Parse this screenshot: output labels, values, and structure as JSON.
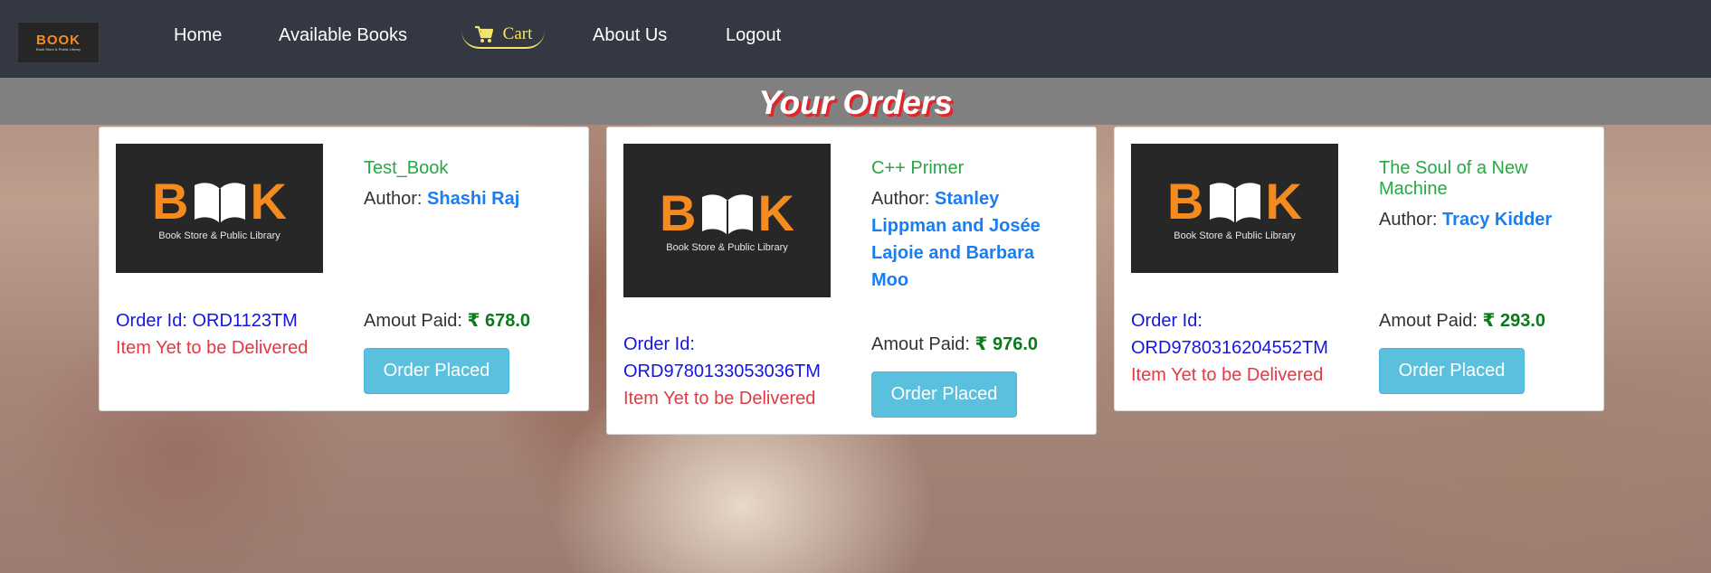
{
  "brand": {
    "logo_text": "BOOK",
    "logo_sub": "Book Store & Public Library"
  },
  "nav": {
    "home": "Home",
    "available_books": "Available Books",
    "cart": "Cart",
    "about": "About Us",
    "logout": "Logout"
  },
  "page_title": "Your Orders",
  "orders": [
    {
      "cover_text": "BOOK",
      "cover_sub": "Book Store & Public Library",
      "title": "Test_Book",
      "author_label": "Author:",
      "author": "Shashi Raj",
      "order_id_label": "Order Id:",
      "order_id": "ORD1123TM",
      "status": "Item Yet to be Delivered",
      "paid_label": "Amout Paid:",
      "amount": "₹ 678.0",
      "button": "Order Placed"
    },
    {
      "cover_text": "BOOK",
      "cover_sub": "Book Store & Public Library",
      "title": "C++ Primer",
      "author_label": "Author:",
      "author": "Stanley Lippman and Josée Lajoie and Barbara Moo",
      "order_id_label": "Order Id:",
      "order_id": "ORD9780133053036TM",
      "status": "Item Yet to be Delivered",
      "paid_label": "Amout Paid:",
      "amount": "₹ 976.0",
      "button": "Order Placed"
    },
    {
      "cover_text": "BOOK",
      "cover_sub": "Book Store & Public Library",
      "title": "The Soul of a New Machine",
      "author_label": "Author:",
      "author": "Tracy Kidder",
      "order_id_label": "Order Id:",
      "order_id": "ORD9780316204552TM",
      "status": "Item Yet to be Delivered",
      "paid_label": "Amout Paid:",
      "amount": "₹ 293.0",
      "button": "Order Placed"
    }
  ],
  "colors": {
    "navbar": "#333842",
    "heading_bar": "#808080",
    "accent_orange": "#f58b1f",
    "title_green": "#28a745",
    "author_blue": "#1a7ef0",
    "order_id_blue": "#1515e0",
    "status_red": "#e13a44",
    "amount_green": "#0a7a1a",
    "button": "#5bc0de"
  }
}
